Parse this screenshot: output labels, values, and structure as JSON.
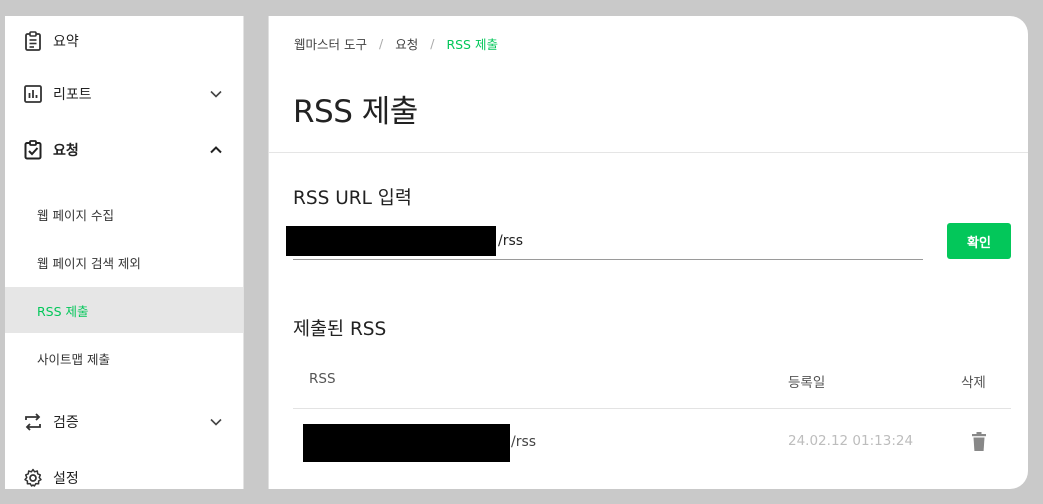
{
  "sidebar": {
    "summary_label": "요약",
    "report_label": "리포트",
    "request_label": "요청",
    "sub_items": [
      "웹 페이지 수집",
      "웹 페이지 검색 제외",
      "RSS 제출",
      "사이트맵 제출"
    ],
    "verify_label": "검증",
    "settings_label": "설정"
  },
  "breadcrumb": [
    "웹마스터 도구",
    "요청",
    "RSS 제출"
  ],
  "page_title": "RSS 제출",
  "input_section": {
    "title": "RSS URL 입력",
    "value_suffix": "/rss",
    "confirm_label": "확인"
  },
  "submitted_section": {
    "title": "제출된 RSS",
    "columns": [
      "RSS",
      "등록일",
      "삭제"
    ],
    "rows": [
      {
        "rss_suffix": "/rss",
        "date": "24.02.12 01:13:24"
      }
    ]
  },
  "colors": {
    "accent": "#03c75a",
    "active_bg": "#e6e6e6"
  },
  "icons": [
    "clipboard-list-icon",
    "bar-chart-icon",
    "clipboard-check-icon",
    "swap-arrows-icon",
    "gear-icon",
    "chevron-down-icon",
    "chevron-up-icon",
    "trash-icon"
  ]
}
